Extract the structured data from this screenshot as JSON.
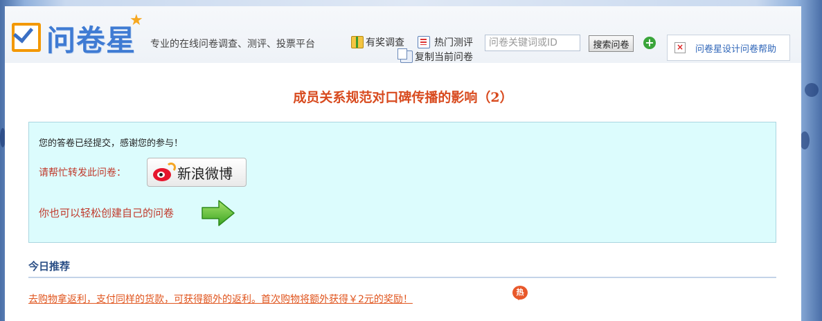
{
  "header": {
    "logo_text": "问卷星",
    "slogan": "专业的在线问卷调查、测评、投票平台",
    "links": {
      "rewards": "有奖调查",
      "hot": "热门测评",
      "copy": "复制当前问卷"
    },
    "search": {
      "placeholder": "问卷关键词或ID",
      "value": "",
      "button_label": "搜索问卷"
    },
    "help_link": "问卷星设计问卷帮助"
  },
  "survey": {
    "title": "成员关系规范对口碑传播的影响（2）"
  },
  "notice": {
    "thanks": "您的答卷已经提交，感谢您的参与！",
    "share_label": "请帮忙转发此问卷：",
    "weibo_button": "新浪微博",
    "create_label": "你也可以轻松创建自己的问卷"
  },
  "recommend": {
    "title": "今日推荐",
    "promo": "去购物拿返利，支付同样的货款，可获得额外的返利。首次购物将额外获得￥2元的奖励！",
    "hot_badge": "热"
  },
  "colors": {
    "title": "#d84a1e",
    "notice_bg": "#dcfcfd",
    "brand": "#3f7bd3",
    "accent": "#f39800"
  }
}
